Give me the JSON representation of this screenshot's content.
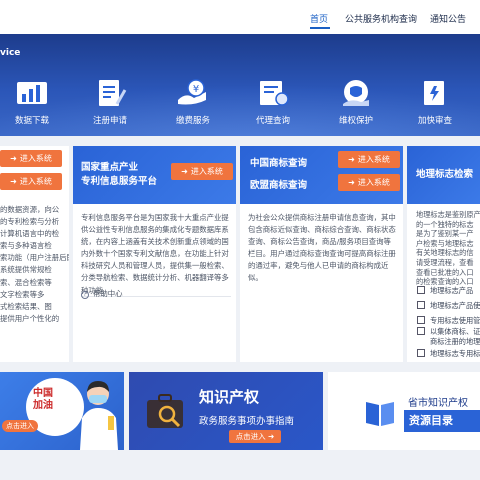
{
  "nav": {
    "items": [
      "首页",
      "公共服务机构查询",
      "通知公告"
    ]
  },
  "hero": {
    "brand_fragment": "vice",
    "services": [
      {
        "label": "数据下载",
        "icon": "chart-icon"
      },
      {
        "label": "注册申请",
        "icon": "document-pen-icon"
      },
      {
        "label": "缴费服务",
        "icon": "yen-payment-icon"
      },
      {
        "label": "代理查询",
        "icon": "certificate-icon"
      },
      {
        "label": "维权保护",
        "icon": "shield-hand-icon"
      },
      {
        "label": "加快审查",
        "icon": "fast-doc-icon"
      }
    ]
  },
  "cards": {
    "left": {
      "enter_labels": [
        "进入系统",
        "进入系统"
      ],
      "body": [
        "的数据资源，向公",
        "的专利检索与分析",
        "计算机语言中的检",
        "索与多种语言检",
        "索功能（用户注册后即",
        "",
        "系统提供常规检",
        "索、混合检索等",
        "文字检索等多",
        "式检索结果、图",
        "提供用户个性化的"
      ]
    },
    "patent": {
      "title_lines": [
        "国家重点产业",
        "专利信息服务平台"
      ],
      "enter_label": "进入系统",
      "body": [
        "专利信息服务平台是为国家我十大重点产业提",
        "供公益性专利信息服务的集成化专题数据库系",
        "统，在内容上涵盖有关技术创新重点领域的国",
        "内外数十个国家专利文献信息，在功能上针对",
        "科技研究人员和管理人员，提供集一般检索、",
        "分类导航检索、数据统计分析、机器翻译等多",
        "种功能。"
      ],
      "help": "帮助中心"
    },
    "trademark": {
      "titles": [
        "中国商标查询",
        "欧盟商标查询"
      ],
      "enter_labels": [
        "进入系统",
        "进入系统"
      ],
      "body": [
        "为社会公众提供商标注册申请信息查询，其中",
        "包含商标近似查询、商标综合查询、商标状态",
        "查询、商标公告查询，商品/服务项目查询等",
        "栏目。用户通过商标查询查询可提高商标注册",
        "的通过率，避免与他人已申请的商标构成近",
        "似。"
      ]
    },
    "gi": {
      "title": "地理标志检索",
      "body": [
        "地理标志是鉴别原产",
        "的一个独特的标志",
        "是为了鉴别某一产",
        "户检索与地理标志",
        "有关地理标志的信",
        "请受理流程，查看",
        "查看已批准的入口",
        "的检索查询的入口"
      ],
      "links": [
        "地理标志产品",
        "地理标志产品使用",
        "专用标志使用管理",
        "以集体商标、证明",
        "商标注册的地理标",
        "地理标志专用标志"
      ]
    }
  },
  "banners": {
    "left": {
      "text": [
        "中国",
        "加油"
      ],
      "button": "点击进入"
    },
    "center": {
      "title": "知识产权",
      "subtitle": "政务服务事项办事指南",
      "button": "点击进入"
    },
    "right": {
      "title": "省市知识产权",
      "tag": "资源目录"
    }
  },
  "colors": {
    "primary": "#2a63d6",
    "accent": "#f0743e",
    "nav_active": "#1a5fc4"
  }
}
